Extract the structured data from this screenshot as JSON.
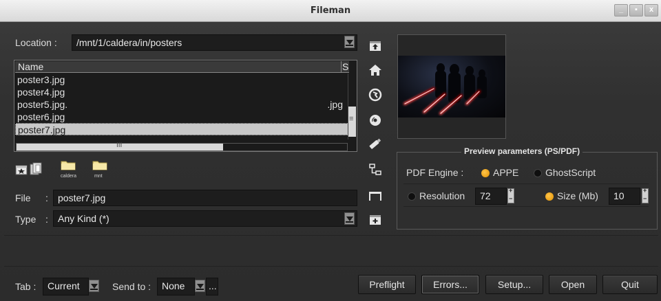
{
  "window": {
    "title": "Fileman",
    "controls": [
      "_",
      "▪",
      "x"
    ]
  },
  "location": {
    "label": "Location :",
    "value": "/mnt/1/caldera/in/posters"
  },
  "file_list": {
    "headers": [
      "Name",
      "S"
    ],
    "rows": [
      {
        "name": "poster3.jpg",
        "ext": ""
      },
      {
        "name": "poster4.jpg",
        "ext": ""
      },
      {
        "name": "poster5.jpg.",
        "ext": ".jpg"
      },
      {
        "name": "poster6.jpg",
        "ext": ""
      },
      {
        "name": "poster7.jpg",
        "ext": "",
        "selected": true
      }
    ],
    "hscroll_grip": "III"
  },
  "bookmarks": [
    {
      "label": "caldera"
    },
    {
      "label": "mnt"
    }
  ],
  "file": {
    "label": "File",
    "sep": ":",
    "value": "poster7.jpg"
  },
  "type": {
    "label": "Type",
    "sep": ":",
    "value": "Any Kind (*)"
  },
  "side_icons": [
    "up-folder-icon",
    "home-icon",
    "network-icon",
    "disc-icon",
    "usb-icon",
    "tree-icon",
    "shelf-icon",
    "new-folder-icon"
  ],
  "preview_params": {
    "title": "Preview parameters (PS/PDF)",
    "engine_label": "PDF Engine :",
    "engines": [
      {
        "label": "APPE",
        "selected": true
      },
      {
        "label": "GhostScript",
        "selected": false
      }
    ],
    "resolution": {
      "label": "Resolution",
      "value": "72",
      "selected": false
    },
    "size": {
      "label": "Size (Mb)",
      "value": "10",
      "selected": true
    }
  },
  "bottom": {
    "tab_label": "Tab :",
    "tab_value": "Current",
    "sendto_label": "Send to :",
    "sendto_value": "None",
    "sendto_more": "...",
    "buttons": [
      "Preflight",
      "Errors...",
      "Setup...",
      "Open",
      "Quit"
    ]
  },
  "colors": {
    "accent": "#f5a623",
    "background": "#2e2e2e",
    "field": "#1d1d1d",
    "selection": "#c8c8c8"
  }
}
